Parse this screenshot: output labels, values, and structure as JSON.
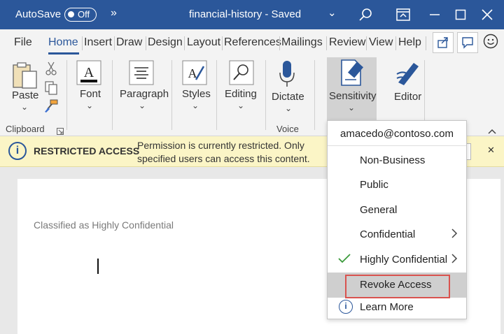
{
  "titlebar": {
    "autosave_label": "AutoSave",
    "autosave_state": "Off",
    "overflow": "»",
    "document_title": "financial-history  -  Saved",
    "title_chevron": "⌄"
  },
  "tabs": [
    "File",
    "Home",
    "Insert",
    "Draw",
    "Design",
    "Layout",
    "References",
    "Mailings",
    "Review",
    "View",
    "Help"
  ],
  "ribbon": {
    "paste": "Paste",
    "font": "Font",
    "paragraph": "Paragraph",
    "styles": "Styles",
    "editing": "Editing",
    "dictate": "Dictate",
    "sensitivity": "Sensitivity",
    "editor": "Editor",
    "group_clipboard": "Clipboard",
    "group_voice": "Voice",
    "chevron": "⌄"
  },
  "message_bar": {
    "title": "RESTRICTED ACCESS",
    "line1": "Permission is currently restricted. Only",
    "line2": "specified users can access this content.",
    "close": "✕"
  },
  "document": {
    "classification": "Classified as Highly Confidential"
  },
  "sensitivity_menu": {
    "account": "amacedo@contoso.com",
    "items": [
      "Non-Business",
      "Public",
      "General",
      "Confidential",
      "Highly Confidential",
      "Revoke Access",
      "Learn More"
    ],
    "checked_item": "Highly Confidential",
    "highlighted_item": "Revoke Access"
  },
  "colors": {
    "title_bar": "#2b579a",
    "message_bar": "#fbf5c6",
    "highlight_border": "#d9534f",
    "check": "#3a9a3a"
  }
}
